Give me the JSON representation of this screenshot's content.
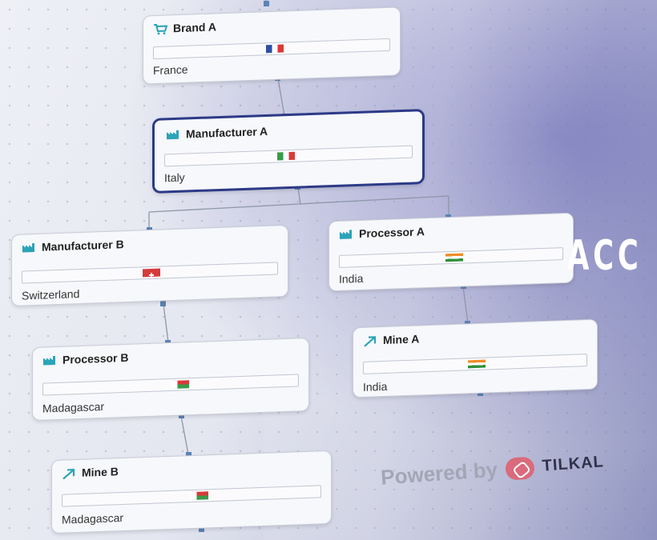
{
  "nodes": {
    "brand_a": {
      "name": "Brand A",
      "country": "France",
      "icon": "cart-icon",
      "flag": "fr"
    },
    "manufacturer_a": {
      "name": "Manufacturer A",
      "country": "Italy",
      "icon": "factory-icon",
      "flag": "it"
    },
    "manufacturer_b": {
      "name": "Manufacturer B",
      "country": "Switzerland",
      "icon": "factory-icon",
      "flag": "ch"
    },
    "processor_a": {
      "name": "Processor A",
      "country": "India",
      "icon": "factory-icon",
      "flag": "in"
    },
    "processor_b": {
      "name": "Processor B",
      "country": "Madagascar",
      "icon": "factory-icon",
      "flag": "mg"
    },
    "mine_a": {
      "name": "Mine A",
      "country": "India",
      "icon": "mine-arrow-icon",
      "flag": "in"
    },
    "mine_b": {
      "name": "Mine B",
      "country": "Madagascar",
      "icon": "mine-arrow-icon",
      "flag": "mg"
    }
  },
  "selected_node": "manufacturer_a",
  "banner": {
    "text": "ACC"
  },
  "footer": {
    "powered_by": "Powered by",
    "brand": "TILKAL"
  },
  "colors": {
    "selected_border": "#2c3a87",
    "connector": "#5b83b5",
    "icon_teal": "#2aa3b8",
    "logo": "#d96b7c"
  }
}
